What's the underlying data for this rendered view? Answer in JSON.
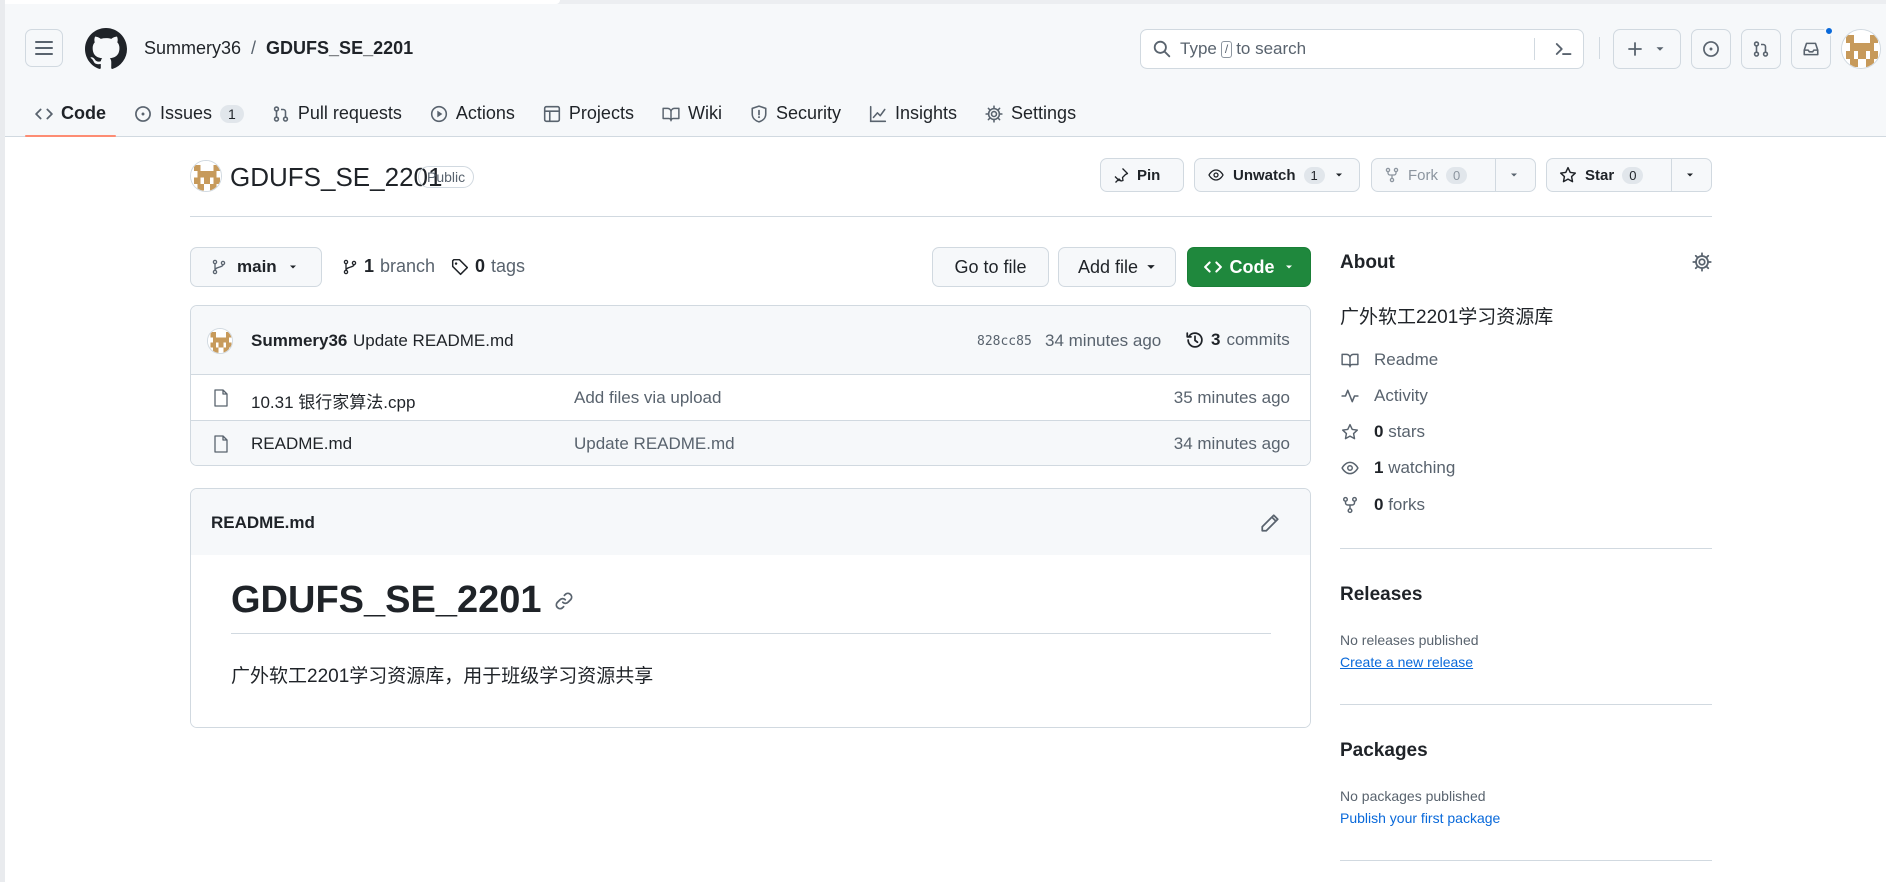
{
  "header": {
    "owner": "Summery36",
    "separator": "/",
    "repo": "GDUFS_SE_2201",
    "search_prefix": "Type",
    "search_key": "/",
    "search_suffix": "to search"
  },
  "tabs": [
    {
      "label": "Code",
      "icon": "code-icon",
      "active": true
    },
    {
      "label": "Issues",
      "icon": "issue-icon",
      "count": "1"
    },
    {
      "label": "Pull requests",
      "icon": "pull-request-icon"
    },
    {
      "label": "Actions",
      "icon": "play-icon"
    },
    {
      "label": "Projects",
      "icon": "table-icon"
    },
    {
      "label": "Wiki",
      "icon": "book-icon"
    },
    {
      "label": "Security",
      "icon": "shield-icon"
    },
    {
      "label": "Insights",
      "icon": "graph-icon"
    },
    {
      "label": "Settings",
      "icon": "gear-icon"
    }
  ],
  "repo": {
    "name": "GDUFS_SE_2201",
    "visibility": "Public",
    "pin_label": "Pin",
    "unwatch_label": "Unwatch",
    "watch_count": "1",
    "fork_label": "Fork",
    "fork_count": "0",
    "star_label": "Star",
    "star_count": "0"
  },
  "branch": {
    "current": "main",
    "branch_count": "1",
    "branch_word": "branch",
    "tag_count": "0",
    "tag_word": "tags",
    "go_to_file": "Go to file",
    "add_file": "Add file",
    "code": "Code"
  },
  "latest_commit": {
    "author": "Summery36",
    "message": "Update README.md",
    "sha": "828cc85",
    "age": "34 minutes ago",
    "commit_count": "3",
    "commit_word": "commits"
  },
  "files": [
    {
      "name": "10.31 银行家算法.cpp",
      "message": "Add files via upload",
      "age": "35 minutes ago"
    },
    {
      "name": "README.md",
      "message": "Update README.md",
      "age": "34 minutes ago"
    }
  ],
  "readme": {
    "file": "README.md",
    "heading": "GDUFS_SE_2201",
    "paragraph": "广外软工2201学习资源库，用于班级学习资源共享"
  },
  "about": {
    "title": "About",
    "description": "广外软工2201学习资源库",
    "readme": "Readme",
    "activity": "Activity",
    "stars_count": "0",
    "stars_word": "stars",
    "watching_count": "1",
    "watching_word": "watching",
    "forks_count": "0",
    "forks_word": "forks"
  },
  "releases": {
    "title": "Releases",
    "empty": "No releases published",
    "link": "Create a new release"
  },
  "packages": {
    "title": "Packages",
    "empty": "No packages published",
    "link": "Publish your first package"
  },
  "colors": {
    "accent_green": "#1f883d",
    "link_blue": "#0969da",
    "tab_underline": "#fd8c73",
    "notification_dot": "#0969da"
  }
}
